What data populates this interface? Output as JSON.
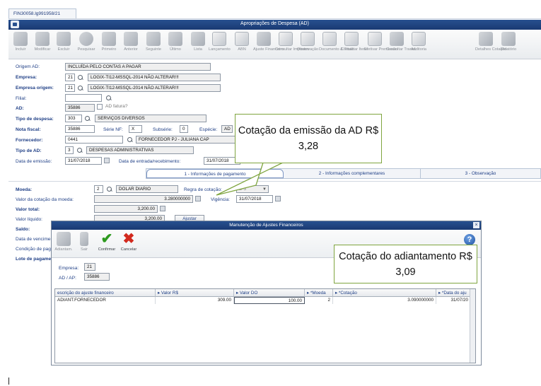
{
  "tab_label": "FIN30058.lg991958/21",
  "window_title": "Apropriações de Despesa (AD)",
  "toolbar": [
    {
      "label": "Incluir",
      "icon": "add-doc-icon"
    },
    {
      "label": "Modificar",
      "icon": "edit-icon"
    },
    {
      "label": "Excluir",
      "icon": "trash-icon"
    },
    {
      "label": "Pesquisar",
      "icon": "search-icon"
    },
    {
      "label": "Primeiro",
      "icon": "first-arrow-icon"
    },
    {
      "label": "Anterior",
      "icon": "prev-arrow-icon"
    },
    {
      "label": "Seguinte",
      "icon": "next-arrow-icon"
    },
    {
      "label": "Último",
      "icon": "last-arrow-icon"
    },
    {
      "label": "Lista",
      "icon": "list-icon"
    },
    {
      "label": "Lançamento",
      "icon": "pencil-icon"
    },
    {
      "label": "ABN",
      "icon": "abn-doc-icon"
    },
    {
      "label": "Ajuste Financeiro",
      "icon": "gears-icon"
    },
    {
      "label": "Consultar Impostos",
      "icon": "tax-doc-icon"
    },
    {
      "label": "Observação",
      "icon": "note-icon"
    },
    {
      "label": "Documento & Título",
      "icon": "documents-icon"
    },
    {
      "label": "Consultar Itens",
      "icon": "items-doc-icon"
    },
    {
      "label": "Efetivar Premissão",
      "icon": "arrow-box-icon"
    },
    {
      "label": "Consultar Transf.",
      "icon": "transfer-icon"
    },
    {
      "label": "Auditoria",
      "icon": "audit-icon"
    },
    {
      "label": "Detalhes Cotação",
      "icon": "quote-detail-icon"
    },
    {
      "label": "Relatório",
      "icon": "report-icon"
    }
  ],
  "form": {
    "origem_ad": {
      "label": "Origem AD:",
      "value": "INCLUÍDA PELO CONTAS A PAGAR"
    },
    "empresa": {
      "label": "Empresa:",
      "code": "21",
      "name": "LOGIX-TI12-MSSQL-2014 NÃO ALTERAR!!!"
    },
    "empresa_origem": {
      "label": "Empresa origem:",
      "code": "21",
      "name": "LOGIX-TI12-MSSQL-2014 NÃO ALTERAR!!!"
    },
    "filial": {
      "label": "Filial:",
      "value": ""
    },
    "ad": {
      "label": "AD:",
      "value": "35886",
      "fatura_label": "AD fatura?"
    },
    "tipo_despesa": {
      "label": "Tipo de despesa:",
      "code": "303",
      "name": "SERVIÇOS DIVERSOS"
    },
    "nota_fiscal": {
      "label": "Nota fiscal:",
      "value": "35886",
      "serie_label": "Série NF:",
      "serie": "X",
      "subserie_label": "Subsérie:",
      "subserie": "0",
      "especie_label": "Espécie:",
      "especie": "AD"
    },
    "fornecedor": {
      "label": "Fornecedor:",
      "code": "0441",
      "name": "FORNECEDOR PJ - JULIANA CAP"
    },
    "tipo_ad": {
      "label": "Tipo de AD:",
      "code": "3",
      "name": "DESPESAS ADMINISTRATIVAS"
    },
    "data_emissao": {
      "label": "Data de emissão:",
      "value": "31/07/2018",
      "entrada_label": "Data de entrada/recebimento:",
      "entrada": "31/07/2018"
    }
  },
  "subtabs": [
    "1 - Informações de pagamento",
    "2 - Informações complementares",
    "3 - Observação"
  ],
  "pagamento": {
    "moeda_label": "Moeda:",
    "moeda_code": "2",
    "moeda_name": "DOLAR DIARIO",
    "regra_label": "Regra de cotação:",
    "regra_value": "D-3",
    "cotacao_label": "Valor da cotação da moeda:",
    "cotacao_value": "3.280000000",
    "vigencia_label": "Vigência:",
    "vigencia_value": "31/07/2018",
    "valor_total_label": "Valor total:",
    "valor_total": "3,200.00",
    "valor_liquido_label": "Valor líquido:",
    "valor_liquido": "3,200.00",
    "ajustar_label": "Ajustar",
    "saldo_label": "Saldo:",
    "vencimento_label": "Data de vencimento:",
    "condicao_label": "Condição de pagamento:",
    "lote_label": "Lote de pagamento:"
  },
  "callouts": {
    "emissao": "Cotação da emissão da AD R$ 3,28",
    "adiantamento": "Cotação do adiantamento R$ 3,09"
  },
  "dialog": {
    "title": "Manutenção de Ajustes Financeiros",
    "toolbar": [
      {
        "label": "Adiantam.",
        "icon": "advance-icon"
      },
      {
        "label": "Sair",
        "icon": "exit-door-icon"
      },
      {
        "label": "Confirmar",
        "icon": "checkmark-icon"
      },
      {
        "label": "Cancelar",
        "icon": "cancel-x-icon"
      }
    ],
    "empresa_label": "Empresa:",
    "empresa_value": "21",
    "ad_ap_label": "AD / AP:",
    "ad_ap_value": "35886",
    "grid": {
      "headers": [
        "escrição do ajuste financeiro",
        "Valor R$",
        "Valor DO",
        "*Moeda",
        "*Cotação",
        "*Data do aju"
      ],
      "rows": [
        [
          "ADIANT.FORNECEDOR",
          "309.00",
          "100.00",
          "2",
          "3.090000000",
          "31/07/20"
        ]
      ]
    }
  },
  "colors": {
    "title_bar": "#1a3a73",
    "label_blue": "#1f3f86",
    "callout_border": "#7fa53f",
    "confirm_green": "#2e9a1f",
    "cancel_red": "#d22a1e"
  }
}
